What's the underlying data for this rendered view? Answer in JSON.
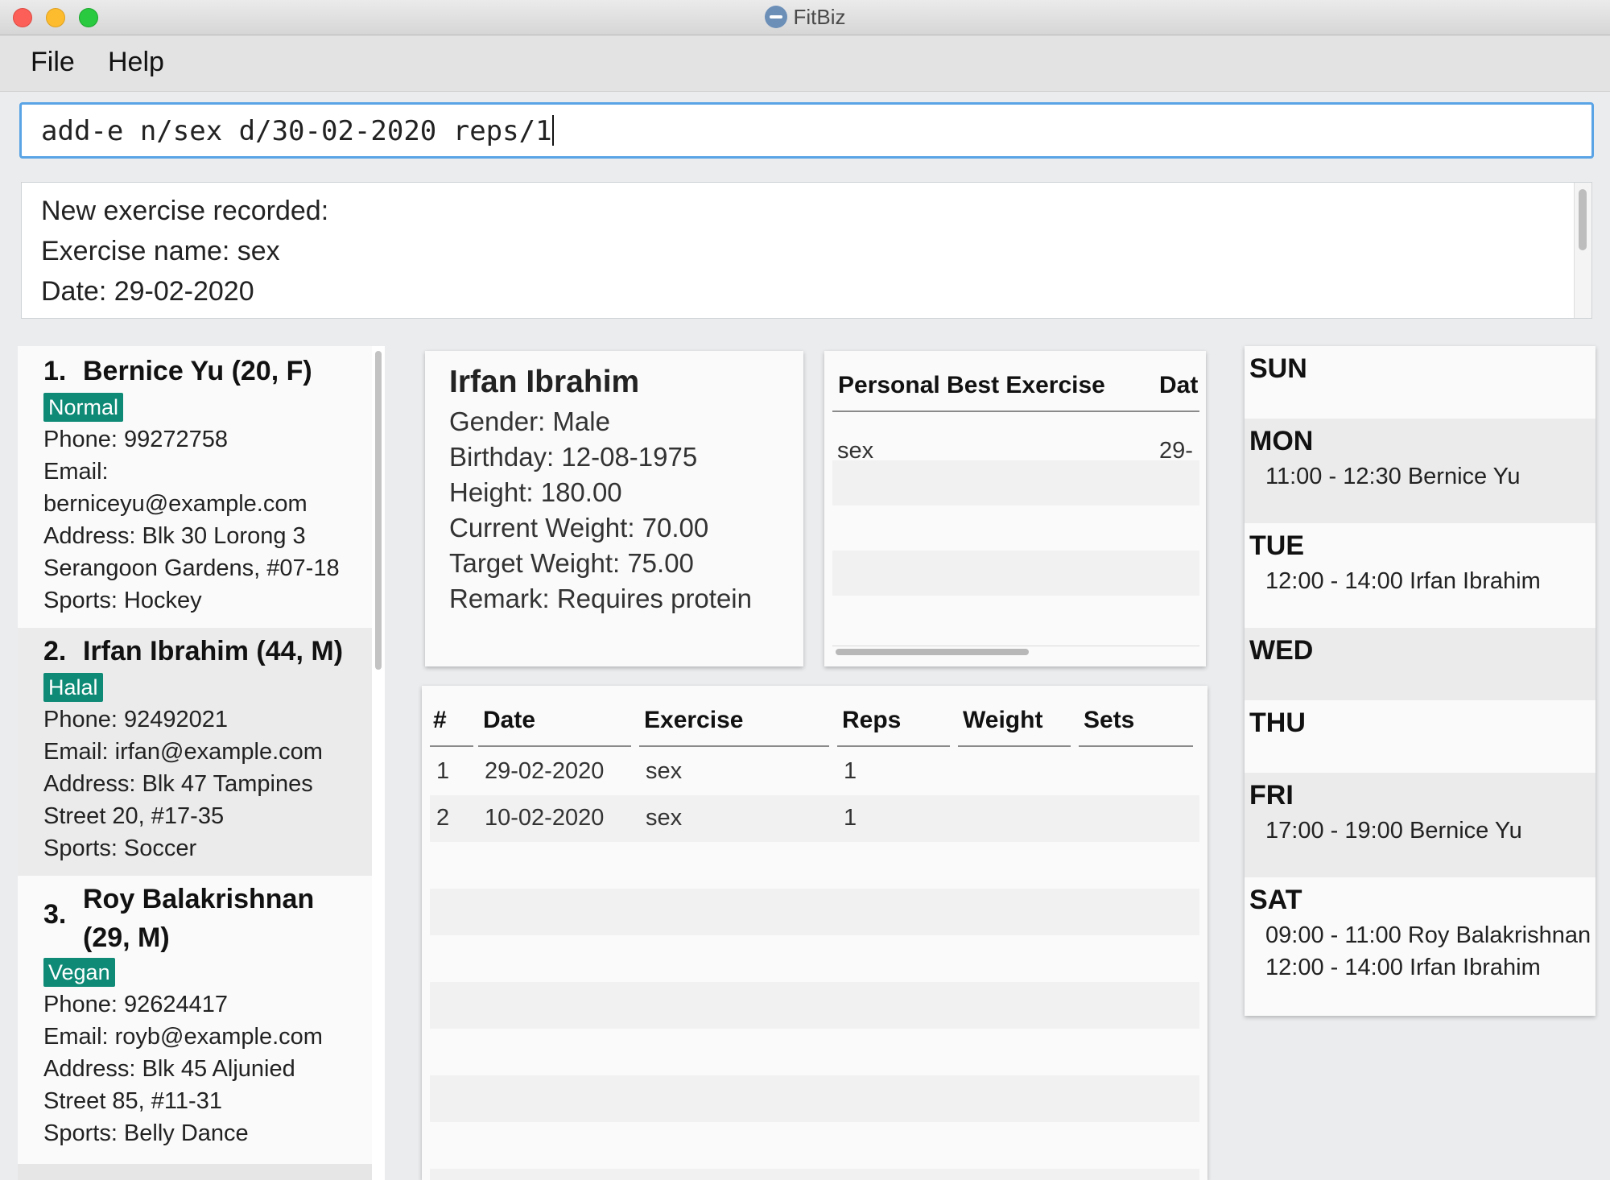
{
  "window": {
    "title": "FitBiz"
  },
  "menu": {
    "file": "File",
    "help": "Help"
  },
  "command": {
    "value": "add-e n/sex d/30-02-2020 reps/1"
  },
  "result": {
    "lines": [
      "New exercise recorded:",
      "Exercise name: sex",
      "Date: 29-02-2020"
    ]
  },
  "clients": [
    {
      "index": "1.",
      "name": "Bernice Yu (20, F)",
      "tag": "Normal",
      "phone": "Phone: 99272758",
      "email_label": "Email:",
      "email": "berniceyu@example.com",
      "address1": "Address: Blk 30 Lorong 3",
      "address2": "Serangoon Gardens, #07-18",
      "sports": "Sports: Hockey"
    },
    {
      "index": "2.",
      "name": "Irfan Ibrahim (44, M)",
      "tag": "Halal",
      "phone": "Phone: 92492021",
      "email": "Email: irfan@example.com",
      "address1": "Address: Blk 47 Tampines",
      "address2": "Street 20, #17-35",
      "sports": "Sports: Soccer"
    },
    {
      "index": "3.",
      "name1": "Roy Balakrishnan",
      "name2": "(29, M)",
      "tag": "Vegan",
      "phone": "Phone: 92624417",
      "email": "Email: royb@example.com",
      "address1": "Address: Blk 45 Aljunied",
      "address2": "Street 85, #11-31",
      "sports": "Sports: Belly Dance"
    }
  ],
  "profile": {
    "name": "Irfan Ibrahim",
    "gender": "Gender: Male",
    "birthday": "Birthday: 12-08-1975",
    "height": "Height: 180.00",
    "current_weight": "Current Weight: 70.00",
    "target_weight": "Target Weight: 75.00",
    "remark": "Remark: Requires protein"
  },
  "personal_best": {
    "headers": [
      "Personal Best Exercise",
      "Dat"
    ],
    "rows": [
      {
        "exercise": "sex",
        "date": "29-"
      }
    ]
  },
  "exercise_table": {
    "headers": [
      "#",
      "Date",
      "Exercise",
      "Reps",
      "Weight",
      "Sets"
    ],
    "rows": [
      {
        "num": "1",
        "date": "29-02-2020",
        "exercise": "sex",
        "reps": "1",
        "weight": "",
        "sets": ""
      },
      {
        "num": "2",
        "date": "10-02-2020",
        "exercise": "sex",
        "reps": "1",
        "weight": "",
        "sets": ""
      }
    ]
  },
  "schedule": {
    "days": [
      {
        "name": "SUN",
        "slots": []
      },
      {
        "name": "MON",
        "slots": [
          "11:00 - 12:30 Bernice Yu"
        ]
      },
      {
        "name": "TUE",
        "slots": [
          "12:00 - 14:00 Irfan Ibrahim"
        ]
      },
      {
        "name": "WED",
        "slots": []
      },
      {
        "name": "THU",
        "slots": []
      },
      {
        "name": "FRI",
        "slots": [
          "17:00 - 19:00 Bernice Yu"
        ]
      },
      {
        "name": "SAT",
        "slots": [
          "09:00 - 11:00 Roy Balakrishnan",
          "12:00 - 14:00 Irfan Ibrahim"
        ]
      }
    ]
  },
  "colors": {
    "tag_bg": "#0e8a76",
    "focus_border": "#5aa4e6",
    "traffic_red": "#fc5f57",
    "traffic_yellow": "#fdbc2e",
    "traffic_green": "#29c940"
  }
}
